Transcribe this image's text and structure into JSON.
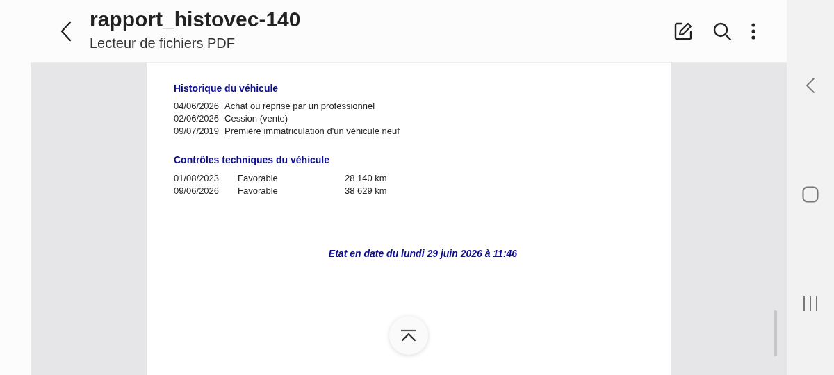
{
  "header": {
    "title": "rapport_histovec-140",
    "subtitle": "Lecteur de fichiers PDF"
  },
  "document": {
    "history": {
      "heading": "Historique du véhicule",
      "rows": [
        {
          "date": "04/06/2026",
          "event": "Achat ou reprise par un professionnel"
        },
        {
          "date": "02/06/2026",
          "event": "Cession (vente)"
        },
        {
          "date": "09/07/2019",
          "event": "Première immatriculation d'un véhicule neuf"
        }
      ]
    },
    "inspections": {
      "heading": "Contrôles techniques du véhicule",
      "rows": [
        {
          "date": "01/08/2023",
          "result": "Favorable",
          "mileage": "28 140 km"
        },
        {
          "date": "09/06/2026",
          "result": "Favorable",
          "mileage": "38 629 km"
        }
      ]
    },
    "footer": "Etat en date du lundi 29 juin 2026 à 11:46"
  }
}
